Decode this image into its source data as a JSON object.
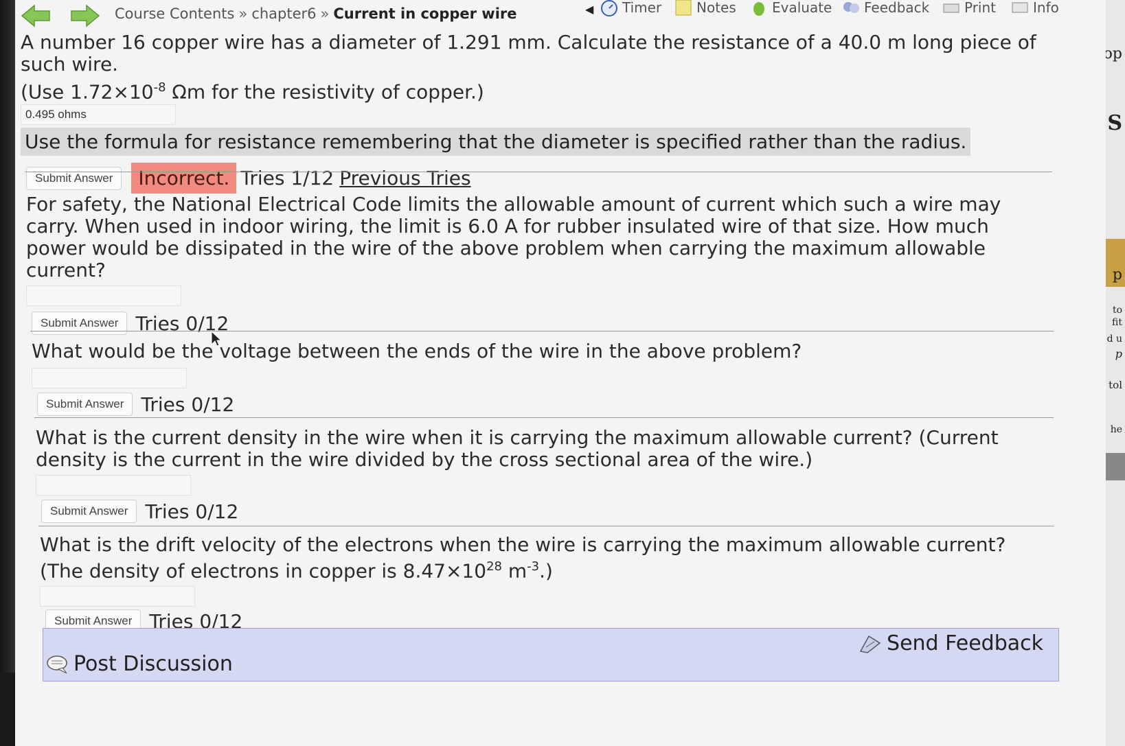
{
  "nav": {
    "back_label": "",
    "forward_label": "",
    "breadcrumb": [
      "Course Contents",
      "chapter6",
      "Current in copper wire"
    ],
    "separator": "»",
    "tools": [
      "Timer",
      "Notes",
      "Evaluate",
      "Feedback",
      "Print",
      "Info"
    ]
  },
  "q1": {
    "text": "A number 16 copper wire has a diameter of 1.291 mm. Calculate the resistance of a 40.0 m long piece of such wire.",
    "resistivity_prefix": "(Use 1.72×10",
    "resistivity_exp": "-8",
    "resistivity_suffix": " Ωm for the resistivity of copper.)",
    "answer_value": "0.495 ohms",
    "hint": "Use the formula for resistance remembering that the diameter is specified rather than the radius.",
    "submit_label": "Submit Answer",
    "status": "Incorrect.",
    "tries": "Tries 1/12",
    "previous_tries": "Previous Tries"
  },
  "q2": {
    "text": "For safety, the National Electrical Code limits the allowable amount of current which such a wire may carry. When used in indoor wiring, the limit is 6.0 A for rubber insulated wire of that size. How much power would be dissipated in the wire of the above problem when carrying the maximum allowable current?",
    "answer_value": "",
    "submit_label": "Submit Answer",
    "tries": "Tries 0/12"
  },
  "q3": {
    "text": "What would be the voltage between the ends of the wire in the above problem?",
    "answer_value": "",
    "submit_label": "Submit Answer",
    "tries": "Tries 0/12"
  },
  "q4": {
    "text": "What is the current density in the wire when it is carrying the maximum allowable current? (Current density is the current in the wire divided by the cross sectional area of the wire.)",
    "answer_value": "",
    "submit_label": "Submit Answer",
    "tries": "Tries 0/12"
  },
  "q5": {
    "text_a": "What is the drift velocity of the electrons when the wire is carrying the maximum allowable current?",
    "text_b_prefix": "(The density of electrons in copper is 8.47×10",
    "text_b_exp1": "28",
    "text_b_mid": " m",
    "text_b_exp2": "-3",
    "text_b_suffix": ".)",
    "answer_value": "",
    "submit_label": "Submit Answer",
    "tries": "Tries 0/12"
  },
  "footer": {
    "post_discussion": "Post Discussion",
    "send_feedback": "Send Feedback"
  },
  "side_fragments": [
    "op",
    "S",
    "p",
    "to",
    "fit",
    "d u",
    "p",
    "tol",
    "he"
  ],
  "colors": {
    "incorrect_bg": "#f18b80",
    "hint_bg": "#d9d9d9",
    "feedback_bar": "#d5d8f2",
    "arrow_green": "#7cc34a"
  }
}
